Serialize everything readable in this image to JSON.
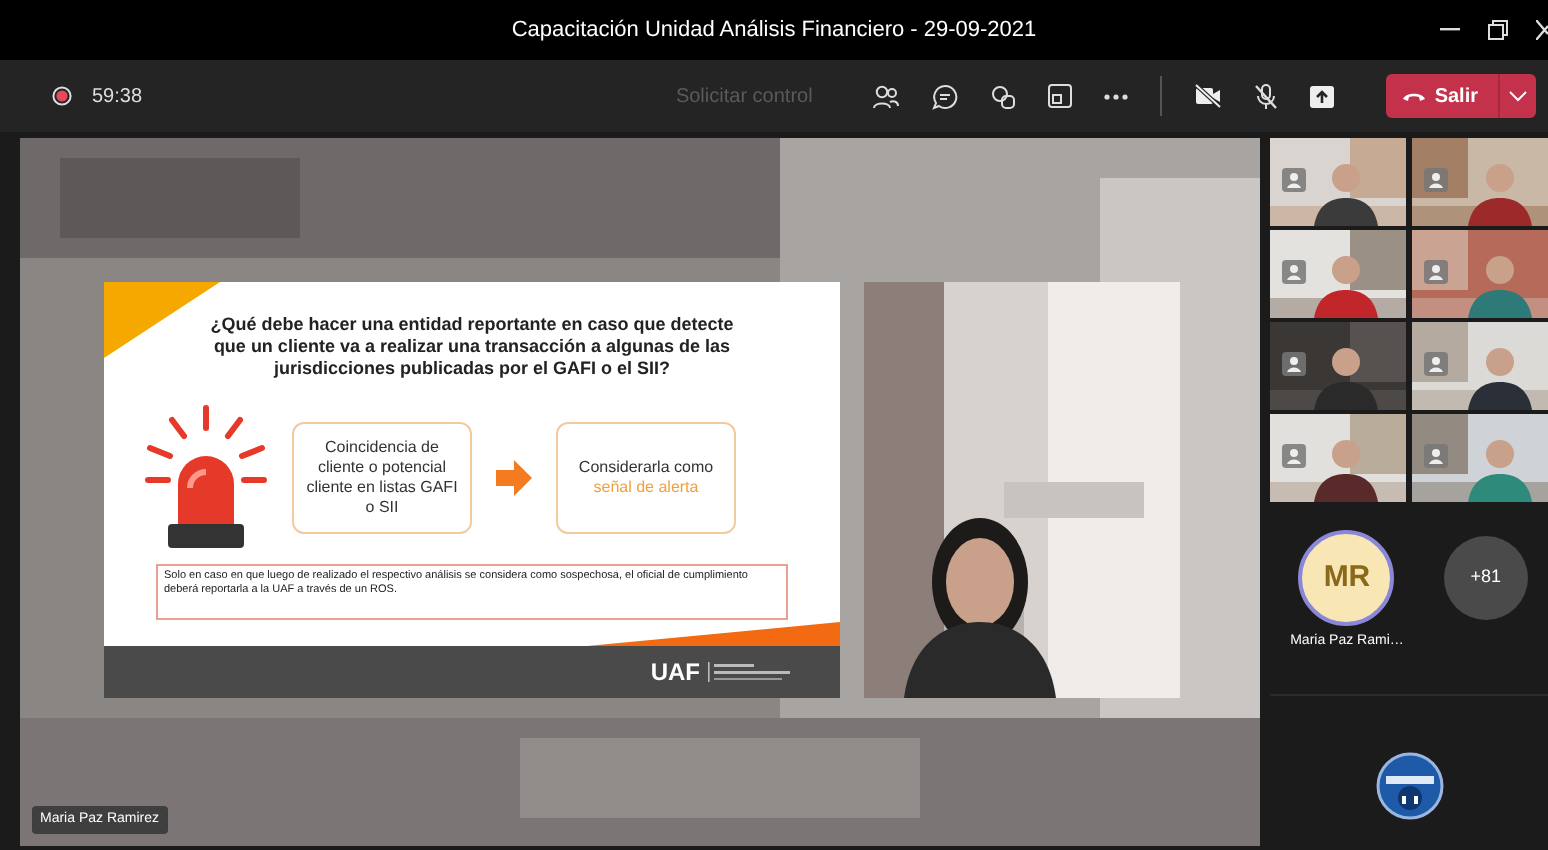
{
  "window": {
    "title": "Capacitación Unidad Análisis Financiero - 29-09-2021"
  },
  "toolbar": {
    "recording": true,
    "timer": "59:38",
    "request_control": {
      "label": "Solicitar control",
      "disabled": true
    },
    "camera_on": false,
    "mic_on": false,
    "leave": {
      "label": "Salir"
    }
  },
  "stage": {
    "slide": {
      "question": "¿Qué debe hacer una entidad reportante en caso que detecte que un cliente va a realizar una transacción a algunas de las jurisdicciones publicadas por el GAFI o el SII?",
      "condition": "Coincidencia de cliente o potencial cliente en listas GAFI o SII",
      "action": "Considerarla como",
      "action_highlight": "señal de alerta",
      "note": "Solo en caso en que luego de realizado el respectivo análisis se considera como sospechosa, el oficial de cumplimiento deberá reportarla a la UAF a través de un ROS.",
      "logo": "UAF"
    },
    "name_tag": "Maria Paz Ramirez"
  },
  "participants": {
    "avatar": {
      "initials": "MR",
      "name": "Maria Paz Rami…"
    },
    "overflow": "+81"
  }
}
